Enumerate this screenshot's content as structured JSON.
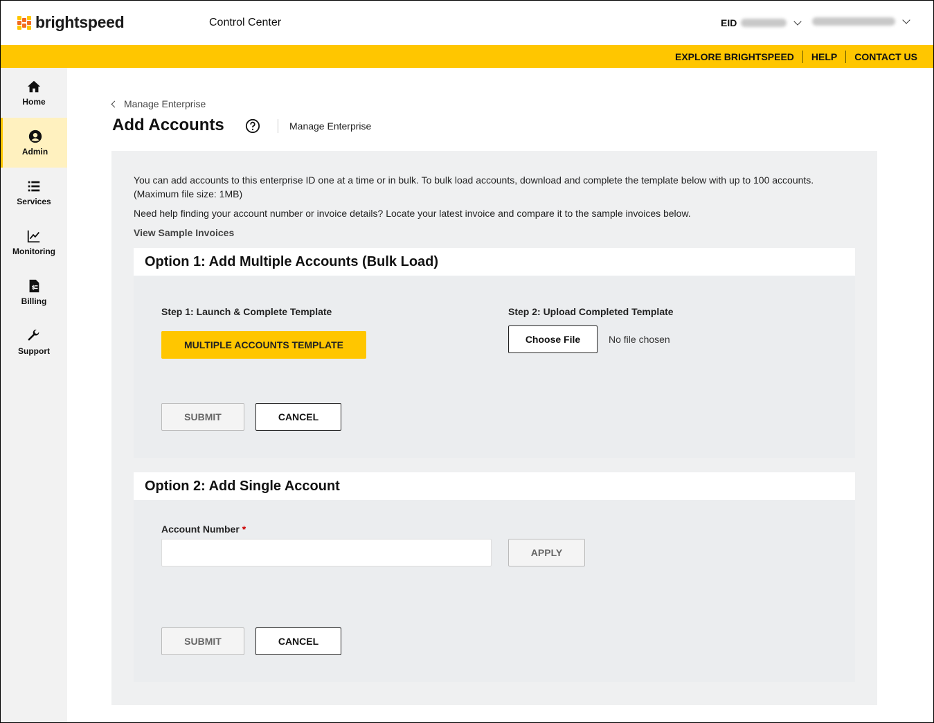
{
  "header": {
    "brand": "brightspeed",
    "app_title": "Control Center",
    "eid_label": "EID",
    "colors": {
      "accent": "#ffc600",
      "logo_orange": "#f26b21",
      "logo_yellow": "#ffc600"
    }
  },
  "top_links": [
    "EXPLORE BRIGHTSPEED",
    "HELP",
    "CONTACT US"
  ],
  "sidebar": {
    "items": [
      {
        "label": "Home",
        "icon": "home-icon"
      },
      {
        "label": "Admin",
        "icon": "user-circle-icon",
        "active": true
      },
      {
        "label": "Services",
        "icon": "list-icon"
      },
      {
        "label": "Monitoring",
        "icon": "chart-icon"
      },
      {
        "label": "Billing",
        "icon": "invoice-icon"
      },
      {
        "label": "Support",
        "icon": "wrench-icon"
      }
    ]
  },
  "page": {
    "breadcrumb": "Manage Enterprise",
    "title": "Add Accounts",
    "subtitle": "Manage Enterprise",
    "intro_1": "You can add accounts to this enterprise ID one at a time or in bulk. To bulk load accounts, download and complete the template below with up to 100 accounts. (Maximum file size: 1MB)",
    "intro_2": "Need help finding your account number or invoice details? Locate your latest invoice and compare it to the sample invoices below.",
    "view_samples": "View Sample Invoices"
  },
  "option1": {
    "heading": "Option 1: Add Multiple Accounts (Bulk Load)",
    "step1_label": "Step 1: Launch & Complete Template",
    "template_button": "MULTIPLE ACCOUNTS TEMPLATE",
    "step2_label": "Step 2: Upload Completed Template",
    "choose_file": "Choose File",
    "no_file": "No file chosen",
    "submit": "SUBMIT",
    "cancel": "CANCEL"
  },
  "option2": {
    "heading": "Option 2: Add Single Account",
    "account_label": "Account Number",
    "required_mark": "*",
    "account_value": "",
    "apply": "APPLY",
    "submit": "SUBMIT",
    "cancel": "CANCEL"
  }
}
